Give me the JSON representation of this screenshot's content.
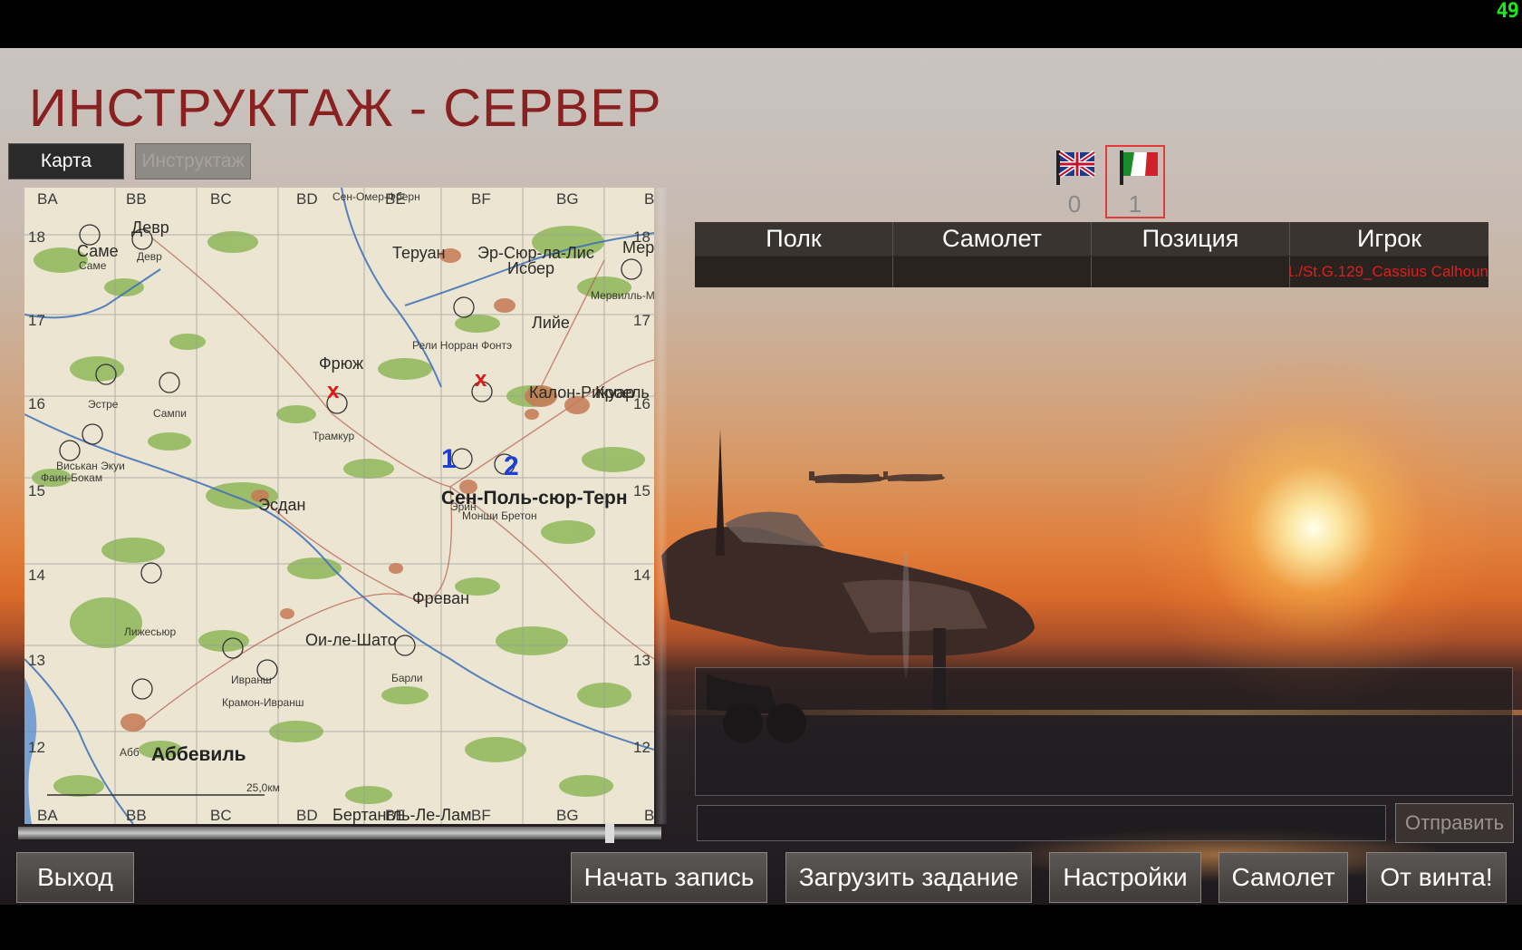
{
  "fps": "49",
  "title": "ИНСТРУКТАЖ - СЕРВЕР",
  "tabs": {
    "map": "Карта",
    "briefing": "Инструктаж"
  },
  "map": {
    "grid_cols_top": [
      "BA",
      "BB",
      "BC",
      "BD",
      "BE",
      "BF",
      "BG",
      "B"
    ],
    "grid_cols_bottom": [
      "BA",
      "BB",
      "BC",
      "BD",
      "BE",
      "BF",
      "BG",
      "B"
    ],
    "grid_rows_left": [
      "18",
      "17",
      "16",
      "15",
      "14",
      "13",
      "12"
    ],
    "grid_rows_right": [
      "18",
      "17",
      "16",
      "15",
      "14",
      "13",
      "12"
    ],
    "towns": {
      "devr": "Девр",
      "devr_small": "Девр",
      "same": "Саме",
      "same_small": "Саме",
      "teruan": "Теруан",
      "er_syur_la_lis": "Эр-Сюр-ла-Лис",
      "isber": "Исбер",
      "merville": "Мер",
      "merville_small": "Мервилль-Мер",
      "lille": "Лийе",
      "reli": "Рели Норран Фонтэ",
      "fryuzh": "Фрюж",
      "kalonn": "Калон-Рикуар",
      "lil_small": "Кроель",
      "estre": "Эстре",
      "sampi": "Сампи",
      "tramkur": "Трамкур",
      "viskan": "Виськан Экуи",
      "fain": "Фаин-Бокам",
      "esdan": "Эсдан",
      "saint_pol": "Сен-Поль-сюр-Терн",
      "monshi": "Монши Бретон",
      "erin": "Эрин",
      "frevan": "Фреван",
      "lizhesur": "Лижесьюр",
      "oi_le_shato": "Ои-ле-Шато",
      "ivranshe": "Ивранш",
      "kramon": "Крамон-Ивранш",
      "bari": "Барли",
      "abbeville": "Аббевиль",
      "abbeville_small": "Абб",
      "bertangl": "Бертангль-Ле-Лам",
      "saint_omer": "Сен-Омер-Фберн",
      "scale": "25,0км"
    },
    "markers": {
      "target_x": "x",
      "wp1": "1",
      "wp2": "2"
    }
  },
  "flags": [
    {
      "name": "uk-flag",
      "count": "0",
      "selected": false
    },
    {
      "name": "axis-flag",
      "count": "1",
      "selected": true
    }
  ],
  "table": {
    "headers": [
      "Полк",
      "Самолет",
      "Позиция",
      "Игрок"
    ],
    "rows": [
      [
        "",
        "",
        "",
        "1./St.G.129_Cassius Calhoun"
      ]
    ]
  },
  "chat": {
    "input": "",
    "send_label": "Отправить"
  },
  "buttons": {
    "exit": "Выход",
    "record": "Начать запись",
    "load_mission": "Загрузить задание",
    "settings": "Настройки",
    "aircraft": "Самолет",
    "fly": "От винта!"
  },
  "colors": {
    "title": "#8a2121",
    "player_red": "#e01e1e",
    "fps_green": "#19e819"
  }
}
